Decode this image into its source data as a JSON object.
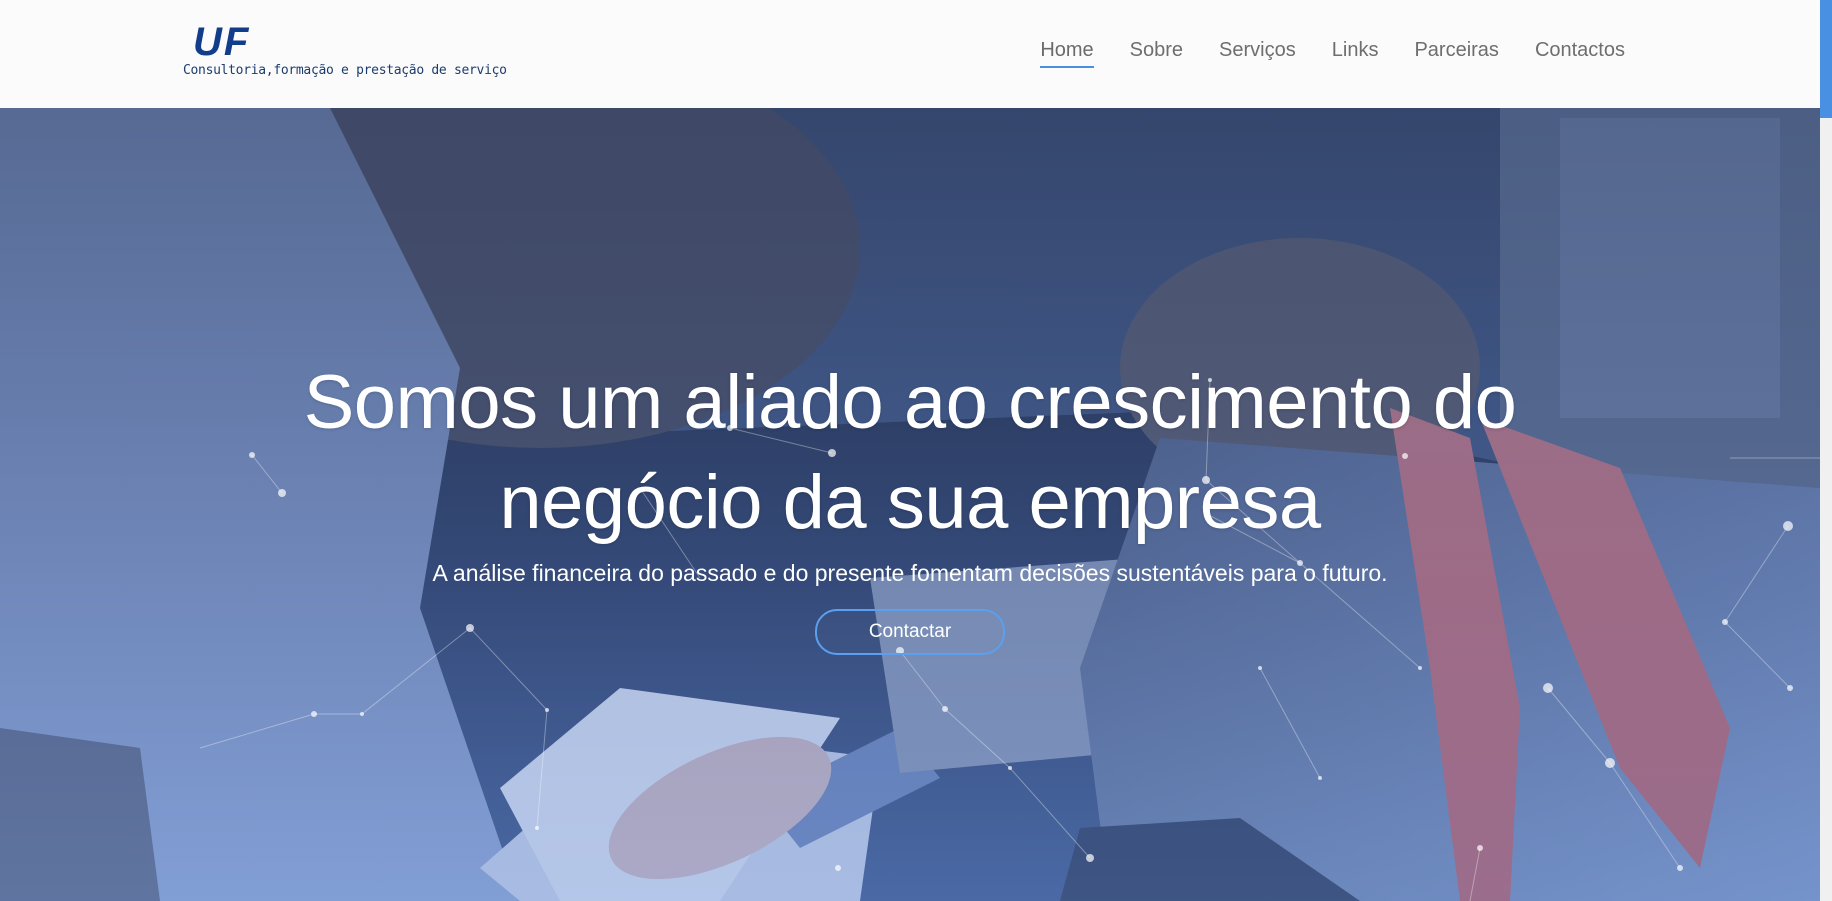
{
  "header": {
    "logo_mark": "UF",
    "logo_tagline": "Consultoria,formação e prestação de serviço",
    "nav": [
      {
        "label": "Home",
        "active": true
      },
      {
        "label": "Sobre",
        "active": false
      },
      {
        "label": "Serviços",
        "active": false
      },
      {
        "label": "Links",
        "active": false
      },
      {
        "label": "Parceiras",
        "active": false
      },
      {
        "label": "Contactos",
        "active": false
      }
    ]
  },
  "hero": {
    "title": "Somos um aliado ao crescimento do negócio da sua empresa",
    "subtitle": "A análise financeira do passado e do presente fomentam decisões sustentáveis para o futuro.",
    "cta_label": "Contactar"
  },
  "colors": {
    "brand": "#123d8a",
    "accent": "#4a90e2",
    "nav_text": "#6e6e6e",
    "header_bg": "#fbfbfb"
  },
  "icons": {
    "background_decoration": "particle-network"
  }
}
